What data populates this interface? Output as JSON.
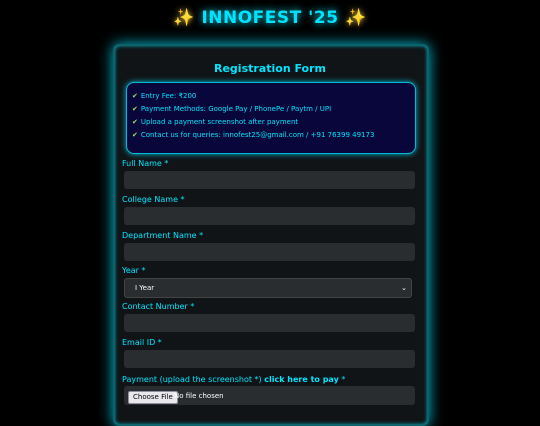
{
  "header": {
    "title": "INNOFEST '25",
    "sparkle": "✨"
  },
  "form": {
    "title": "Registration Form",
    "info": [
      "Entry Fee: ₹200",
      "Payment Methods: Google Pay / PhonePe / Paytm / UPI",
      "Upload a payment screenshot after payment",
      "Contact us for queries: innofest25@gmail.com / +91 76399 49173"
    ],
    "check": "✔",
    "fields": {
      "full_name": "Full Name *",
      "college_name": "College Name *",
      "department_name": "Department Name *",
      "year": "Year *",
      "contact_number": "Contact Number *",
      "email_id": "Email ID *"
    },
    "year_selected": "I Year",
    "payment": {
      "label": "Payment (upload the screenshot *)",
      "link": "click here to pay",
      "star": "*"
    },
    "file": {
      "button": "Choose File",
      "status": "No file chosen"
    }
  },
  "colors": {
    "accent": "#00e5ff",
    "background": "#000000",
    "card": "#101417",
    "info_box": "#08063a",
    "check": "#9be26a"
  }
}
